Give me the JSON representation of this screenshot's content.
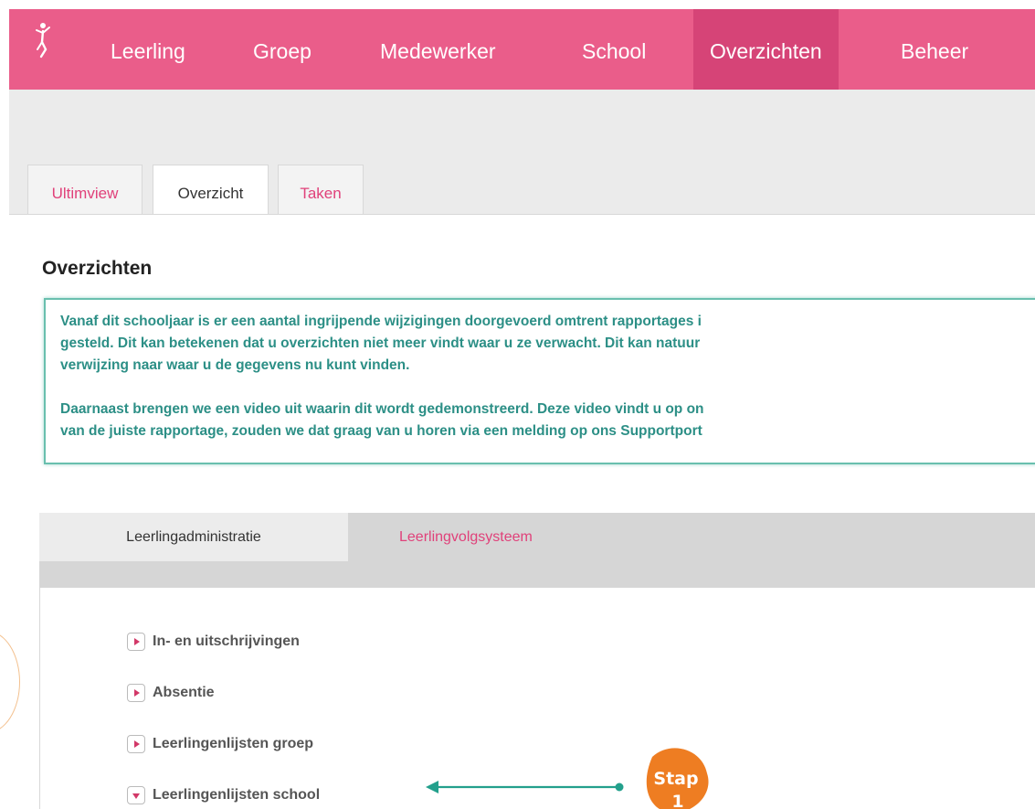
{
  "topnav": {
    "items": [
      {
        "label": "Leerling",
        "active": false
      },
      {
        "label": "Groep",
        "active": false
      },
      {
        "label": "Medewerker",
        "active": false
      },
      {
        "label": "School",
        "active": false
      },
      {
        "label": "Overzichten",
        "active": true
      },
      {
        "label": "Beheer",
        "active": false
      }
    ],
    "logo_icon": "dancer-logo-icon"
  },
  "tabs": [
    {
      "label": "Ultimview",
      "active": false
    },
    {
      "label": "Overzicht",
      "active": true
    },
    {
      "label": "Taken",
      "active": false
    }
  ],
  "page_title": "Overzichten",
  "notice": {
    "line1": "Vanaf dit schooljaar is er een aantal ingrijpende wijzigingen doorgevoerd omtrent rapportages i",
    "line2": "gesteld. Dit kan betekenen dat u overzichten niet meer vindt waar u ze verwacht. Dit kan natuur",
    "line3": "verwijzing naar waar u de gegevens nu kunt vinden.",
    "line4": "Daarnaast brengen we een video uit waarin dit wordt gedemonstreerd. Deze video vindt u op on",
    "line5": "van de juiste rapportage, zouden we dat graag van u horen via een melding op ons Supportport"
  },
  "subtabs": [
    {
      "label": "Leerlingadministratie",
      "active": true
    },
    {
      "label": "Leerlingvolgsysteem",
      "active": false
    }
  ],
  "list": [
    {
      "label": "In- en uitschrijvingen",
      "expanded": false
    },
    {
      "label": "Absentie",
      "expanded": false
    },
    {
      "label": "Leerlingenlijsten groep",
      "expanded": false
    },
    {
      "label": "Leerlingenlijsten school",
      "expanded": true
    }
  ],
  "annotation": {
    "line1": "Stap",
    "line2": "1"
  },
  "colors": {
    "brand": "#ea5d8a",
    "brand_active": "#d64477",
    "link": "#e0417a",
    "notice": "#2c8f86",
    "annotation": "#ee7d22",
    "arrow": "#23a08c"
  }
}
